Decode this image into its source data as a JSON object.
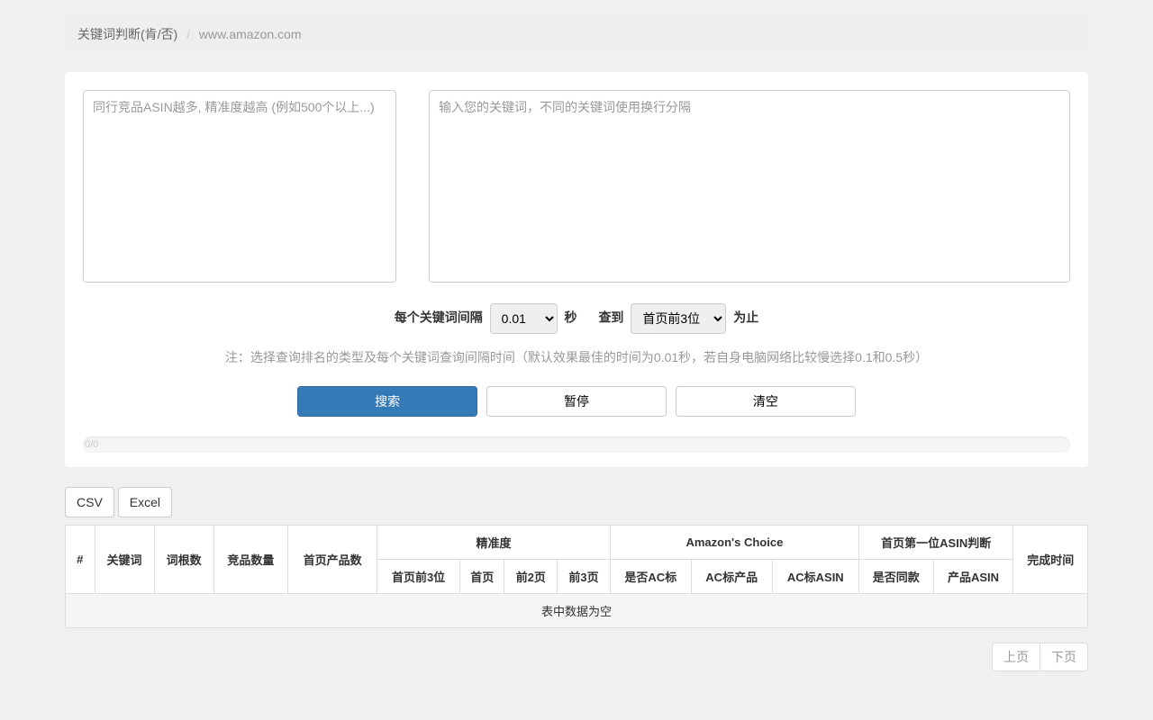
{
  "breadcrumb": {
    "page": "关键词判断(肯/否)",
    "site": "www.amazon.com"
  },
  "inputs": {
    "asin_placeholder": "同行竞品ASIN越多, 精准度越高 (例如500个以上...)",
    "keywords_placeholder": "输入您的关键词，不同的关键词使用换行分隔"
  },
  "controls": {
    "interval_label_pre": "每个关键词间隔",
    "interval_value": "0.01",
    "interval_label_post": "秒",
    "until_label_pre": "查到",
    "until_value": "首页前3位",
    "until_label_post": "为止"
  },
  "note": "注：选择查询排名的类型及每个关键词查询间隔时间（默认效果最佳的时间为0.01秒，若自身电脑网络比较慢选择0.1和0.5秒）",
  "buttons": {
    "search": "搜索",
    "pause": "暂停",
    "clear": "清空"
  },
  "progress": {
    "text": "0/0"
  },
  "export_buttons": {
    "csv": "CSV",
    "excel": "Excel"
  },
  "table": {
    "headers_top": {
      "index": "#",
      "keyword": "关键词",
      "root_count": "词根数",
      "competitor_count": "竞品数量",
      "first_page_products": "首页产品数",
      "precision": "精准度",
      "amazons_choice": "Amazon's Choice",
      "first_asin_judge": "首页第一位ASIN判断",
      "complete_time": "完成时间"
    },
    "headers_sub": {
      "p_top3": "首页前3位",
      "p_page1": "首页",
      "p_page2": "前2页",
      "p_page3": "前3页",
      "ac_is": "是否AC标",
      "ac_product": "AC标产品",
      "ac_asin": "AC标ASIN",
      "same": "是否同款",
      "product_asin": "产品ASIN"
    },
    "empty": "表中数据为空"
  },
  "pager": {
    "prev": "上页",
    "next": "下页"
  }
}
